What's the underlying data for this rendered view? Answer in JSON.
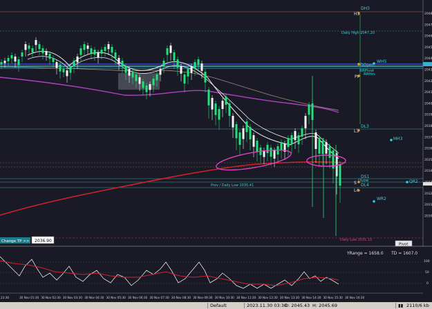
{
  "price_axis": {
    "ticks": [
      "2048",
      "2047",
      "2046",
      "2045",
      "2044",
      "2043",
      "2042",
      "2041",
      "2040",
      "2039",
      "2038",
      "2037",
      "2036",
      "2035",
      "2034",
      "2033",
      "2032",
      "2031",
      "2030"
    ]
  },
  "time_axis": {
    "ticks": [
      "23:30",
      "30 Nov 01:30",
      "30 Nov 02:30",
      "30 Nov 03:30",
      "30 Nov 04:30",
      "30 Nov 05:30",
      "30 Nov 06:30",
      "30 Nov 07:30",
      "30 Nov 08:30",
      "30 Nov 09:30",
      "30 Nov 10:30",
      "30 Nov 11:30",
      "30 Nov 12:30",
      "30 Nov 13:30",
      "30 Nov 14:30",
      "30 Nov 15:30",
      "30 Nov 16:30"
    ]
  },
  "levels": {
    "dh3": "DH3",
    "h3": "H3",
    "daily_high": "Daily High 2047.20",
    "wh5": "WH5",
    "dopen": "DOpen",
    "rrpivot": "RRPivot",
    "rrhrs": "RRHrs",
    "pp": "PP",
    "dl3": "DL3",
    "l3": "L3",
    "mh3": "MH3",
    "ds1": "DS1",
    "dlow": "DLow",
    "s": "S",
    "dl4": "DL4",
    "l4": "L4",
    "qr2": "QR2",
    "wr2": "WR2",
    "prev_daily_low": "Prev / Daily Low 2035.41",
    "daily_low": "Daily Low 2031.15"
  },
  "change_tp": {
    "label": "Change TP >>",
    "value": "2036.90"
  },
  "pivot_button": "Pivot",
  "oscillator": {
    "yrange": "YRange = 1658.0",
    "td": "TD = 1607.0",
    "scale": [
      "100",
      "50",
      "0"
    ]
  },
  "statusbar": {
    "profile": "Default",
    "datetime": "2023.11.30 03:30",
    "open": "O: 2045.43",
    "high": "H: 2045.69",
    "traffic": "2110/6 kb"
  },
  "colors": {
    "background": "#1a1a26",
    "bull": "#22e07a",
    "bear": "#f2f2f2",
    "ma_red": "#d0202a",
    "ma_magenta": "#b040c0",
    "level_cyan": "#40d0d8",
    "ellipse": "#e040c0"
  }
}
